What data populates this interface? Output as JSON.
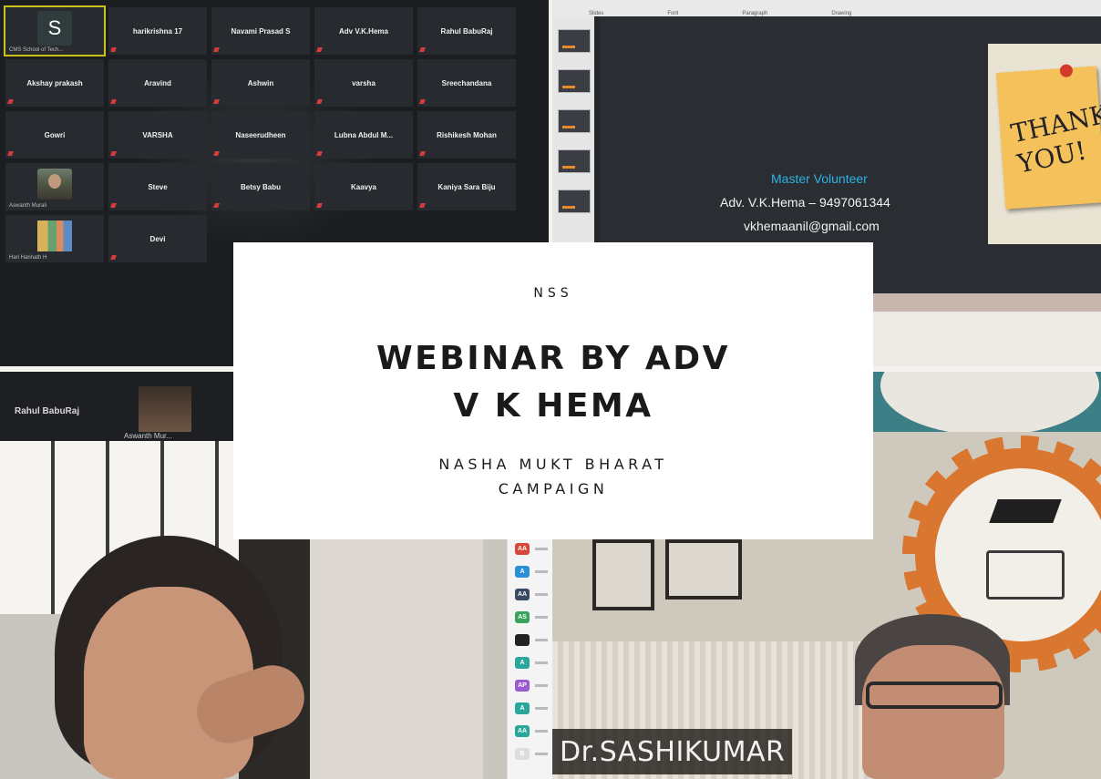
{
  "gallery": {
    "active_initial": "S",
    "active_caption": "CMS School of Tech...",
    "participants": [
      "harikrishna 17",
      "Navami Prasad S",
      "Adv V.K.Hema",
      "Rahul BabuRaj",
      "Akshay prakash",
      "Aravind",
      "Ashwin",
      "varsha",
      "Sreechandana",
      "Gowri",
      "VARSHA",
      "Naseerudheen",
      "Lubna Abdul M...",
      "Rishikesh Mohan",
      "Steve",
      "Betsy Babu",
      "Kaavya",
      "Kaniya Sara Biju",
      "Devi"
    ],
    "bottom_left_caption": "Aswanth Murali",
    "bottom_left2_caption": "Hari Harinath H"
  },
  "slide": {
    "role": "Master Volunteer",
    "name_phone": "Adv. V.K.Hema – 9497061344",
    "email": "vkhemaanil@gmail.com",
    "sticky": "THANK\nYOU!",
    "ribbon": [
      "Slides",
      "Font",
      "Paragraph",
      "Drawing"
    ]
  },
  "speaker": {
    "strip_name": "Rahul BabuRaj",
    "thumb_name": "Aswanth Mur...",
    "chips": [
      {
        "label": "AA",
        "color": "#d9473a"
      },
      {
        "label": "A",
        "color": "#2b8fd6"
      },
      {
        "label": "AA",
        "color": "#3a4a64"
      },
      {
        "label": "AS",
        "color": "#37a35c"
      },
      {
        "label": "",
        "color": "#222222"
      },
      {
        "label": "A",
        "color": "#2aa79b"
      },
      {
        "label": "AP",
        "color": "#9a5bd0"
      },
      {
        "label": "A",
        "color": "#2aa79b"
      },
      {
        "label": "AA",
        "color": "#2aa79b"
      },
      {
        "label": "B",
        "color": "#dddddd"
      }
    ]
  },
  "doctor": {
    "name": "Dr.SASHIKUMAR"
  },
  "card": {
    "org": "NSS",
    "title_line1": "WEBINAR BY ADV",
    "title_line2": "V K HEMA",
    "subtitle_line1": "NASHA MUKT BHARAT",
    "subtitle_line2": "CAMPAIGN"
  }
}
